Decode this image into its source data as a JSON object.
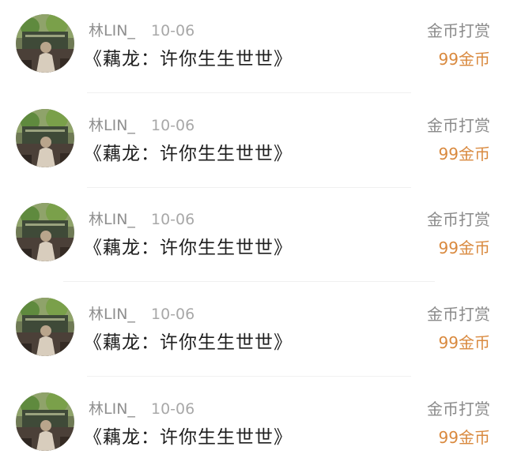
{
  "colors": {
    "username": "#8f8f8f",
    "date": "#a8a8a8",
    "title": "#1e1e1e",
    "tip_label": "#8a8a8a",
    "tip_amount": "#d9893e",
    "divider": "#f0f0f0"
  },
  "items": [
    {
      "user": "林LIN_",
      "date": "10-06",
      "title": "《藕龙：许你生生世世》",
      "tip_label": "金币打赏",
      "tip_amount": "99金币",
      "avatar_icon": "user-avatar-icon"
    },
    {
      "user": "林LIN_",
      "date": "10-06",
      "title": "《藕龙：许你生生世世》",
      "tip_label": "金币打赏",
      "tip_amount": "99金币",
      "avatar_icon": "user-avatar-icon"
    },
    {
      "user": "林LIN_",
      "date": "10-06",
      "title": "《藕龙：许你生生世世》",
      "tip_label": "金币打赏",
      "tip_amount": "99金币",
      "avatar_icon": "user-avatar-icon"
    },
    {
      "user": "林LIN_",
      "date": "10-06",
      "title": "《藕龙：许你生生世世》",
      "tip_label": "金币打赏",
      "tip_amount": "99金币",
      "avatar_icon": "user-avatar-icon"
    },
    {
      "user": "林LIN_",
      "date": "10-06",
      "title": "《藕龙：许你生生世世》",
      "tip_label": "金币打赏",
      "tip_amount": "99金币",
      "avatar_icon": "user-avatar-icon"
    }
  ]
}
